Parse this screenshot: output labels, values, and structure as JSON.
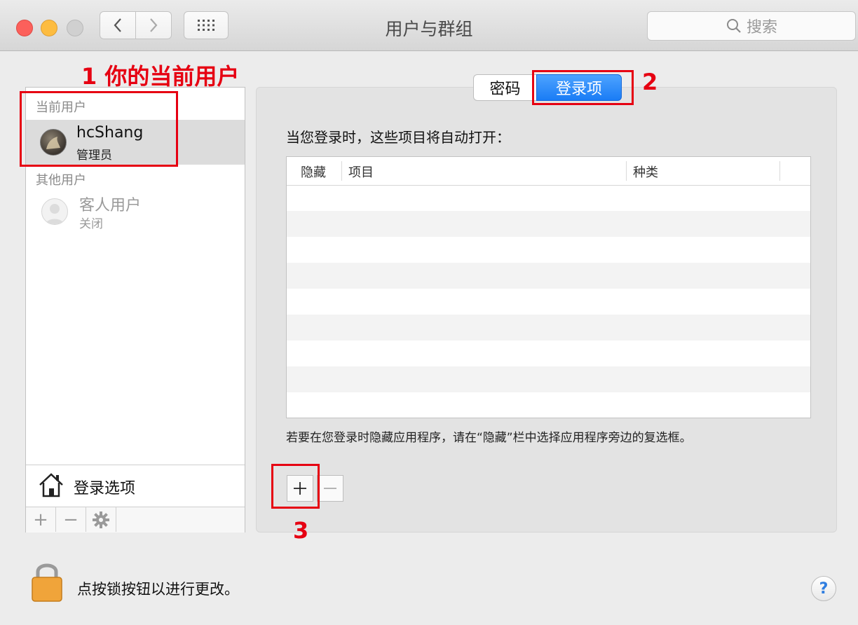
{
  "window": {
    "title": "用户与群组"
  },
  "toolbar": {
    "back": "‹",
    "forward": "›",
    "grid_icon": "grid-icon"
  },
  "search": {
    "placeholder": "搜索"
  },
  "annotations": {
    "label1": "1 你的当前用户",
    "label2": "2",
    "label3": "3",
    "color": "#e60012"
  },
  "sidebar": {
    "current_users_label": "当前用户",
    "current_user": {
      "name": "hcShang",
      "role": "管理员"
    },
    "other_users_label": "其他用户",
    "guest_user": {
      "name": "客人用户",
      "status": "关闭"
    },
    "login_options_label": "登录选项",
    "add": "+",
    "remove": "−"
  },
  "tabs": {
    "password": "密码",
    "login_items": "登录项",
    "active": "login_items",
    "accent": "#1a7cf5"
  },
  "login_items": {
    "heading": "当您登录时，这些项目将自动打开：",
    "columns": [
      "隐藏",
      "项目",
      "种类"
    ],
    "rows": [],
    "hint": "若要在您登录时隐藏应用程序，请在“隐藏”栏中选择应用程序旁边的复选框。",
    "add": "+",
    "remove": "−"
  },
  "footer": {
    "lock_text": "点按锁按钮以进行更改。",
    "help": "?"
  }
}
